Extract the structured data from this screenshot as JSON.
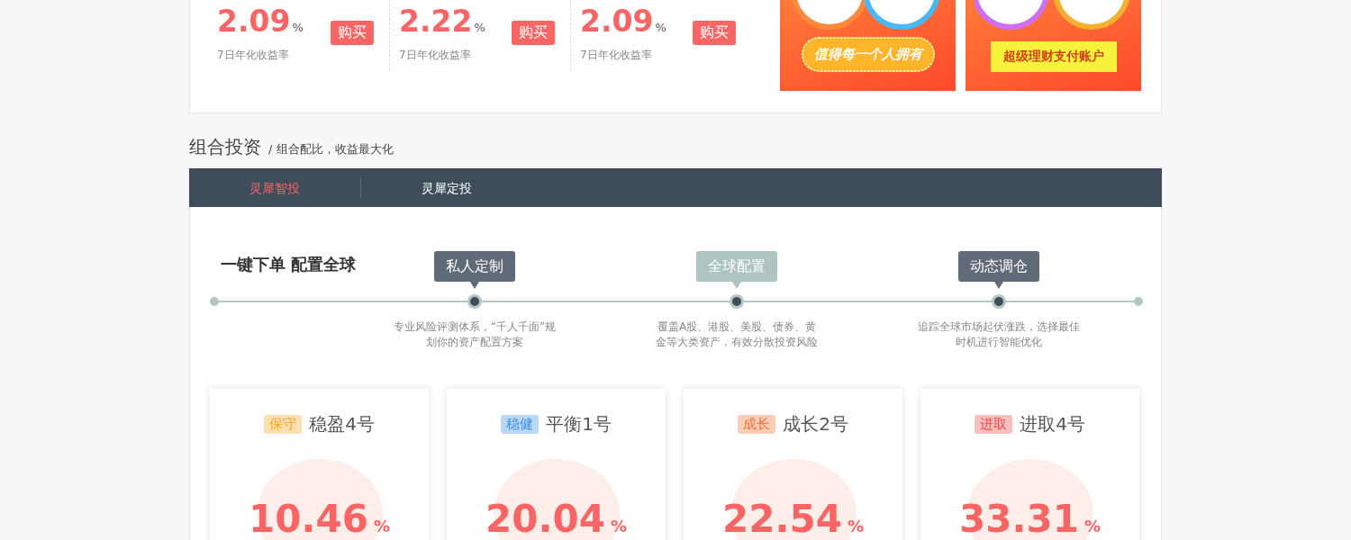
{
  "products": [
    {
      "rate": "2.09",
      "unit": "%",
      "label": "7日年化收益率",
      "button": "购买"
    },
    {
      "rate": "2.22",
      "unit": "%",
      "label": "7日年化收益率",
      "button": "购买"
    },
    {
      "rate": "2.09",
      "unit": "%",
      "label": "7日年化收益率",
      "button": "购买"
    }
  ],
  "banners": [
    {
      "caption": "值得每一个人拥有",
      "kind": "pill"
    },
    {
      "caption": "超级理财支付账户",
      "kind": "ribbon"
    }
  ],
  "section": {
    "title": "组合投资",
    "subtitle": "/ 组合配比，收益最大化"
  },
  "tabs": [
    {
      "label": "灵犀智投",
      "selected": true
    },
    {
      "label": "灵犀定投",
      "selected": false
    }
  ],
  "timeline": {
    "heading": "一键下单 配置全球",
    "steps": [
      {
        "label": "私人定制",
        "selected": false,
        "description": "专业风险评测体系，“千人千面”规划你的资产配置方案"
      },
      {
        "label": "全球配置",
        "selected": true,
        "description": "覆盖A股、港股、美股、债券、黄金等大类资产，有效分散投资风险"
      },
      {
        "label": "动态调仓",
        "selected": false,
        "description": "追踪全球市场起伏涨跌，选择最佳时机进行智能优化"
      }
    ]
  },
  "portfolios": [
    {
      "tag": "保守",
      "color": "#f5a623",
      "name": "稳盈4号",
      "rate": "10.46",
      "unit": "%"
    },
    {
      "tag": "稳健",
      "color": "#3a8ee6",
      "name": "平衡1号",
      "rate": "20.04",
      "unit": "%"
    },
    {
      "tag": "成长",
      "color": "#f07030",
      "name": "成长2号",
      "rate": "22.54",
      "unit": "%"
    },
    {
      "tag": "进取",
      "color": "#e84a4a",
      "name": "进取4号",
      "rate": "33.31",
      "unit": "%"
    }
  ]
}
